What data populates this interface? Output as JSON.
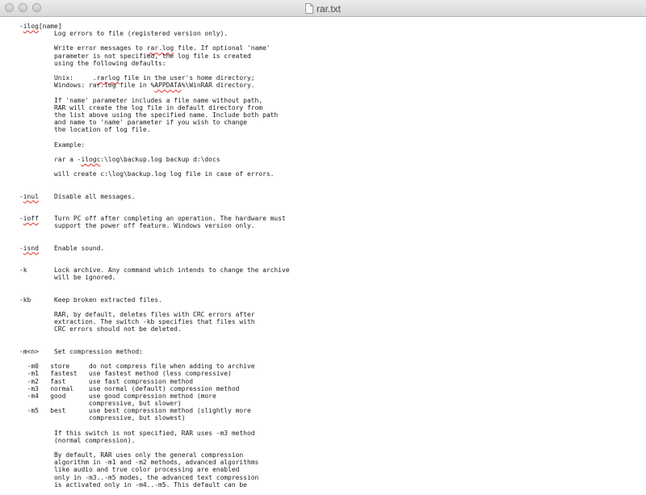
{
  "window": {
    "title": "rar.txt",
    "icon": "text-document-icon",
    "controls": [
      "close-button",
      "minimize-button",
      "zoom-button"
    ]
  },
  "text_lines": [
    "-ilog[name]",
    "         Log errors to file (registered version only).",
    "",
    "         Write error messages to rar.log file. If optional 'name'",
    "         parameter is not specified, the log file is created",
    "         using the following defaults:",
    "",
    "         Unix:     .rarlog file in the user's home directory;",
    "         Windows: rar.log file in %APPDATA%\\WinRAR directory.",
    "",
    "         If 'name' parameter includes a file name without path,",
    "         RAR will create the log file in default directory from",
    "         the list above using the specified name. Include both path",
    "         and name to 'name' parameter if you wish to change",
    "         the location of log file.",
    "",
    "         Example:",
    "",
    "         rar a -ilogc:\\log\\backup.log backup d:\\docs",
    "",
    "         will create c:\\log\\backup.log log file in case of errors.",
    "",
    "",
    "-inul    Disable all messages.",
    "",
    "",
    "-ioff    Turn PC off after completing an operation. The hardware must",
    "         support the power off feature. Windows version only.",
    "",
    "",
    "-isnd    Enable sound.",
    "",
    "",
    "-k       Lock archive. Any command which intends to change the archive",
    "         will be ignored.",
    "",
    "",
    "-kb      Keep broken extracted files.",
    "",
    "         RAR, by default, deletes files with CRC errors after",
    "         extraction. The switch -kb specifies that files with",
    "         CRC errors should not be deleted.",
    "",
    "",
    "-m<n>    Set compression method:",
    "",
    "  -m0   store     do not compress file when adding to archive",
    "  -m1   fastest   use fastest method (less compressive)",
    "  -m2   fast      use fast compression method",
    "  -m3   normal    use normal (default) compression method",
    "  -m4   good      use good compression method (more",
    "                  compressive, but slower)",
    "  -m5   best      use best compression method (slightly more",
    "                  compressive, but slowest)",
    "",
    "         If this switch is not specified, RAR uses -m3 method",
    "         (normal compression).",
    "",
    "         By default, RAR uses only the general compression",
    "         algorithm in -m1 and -m2 methods, advanced algorithms",
    "         like audio and true color processing are enabled",
    "         only in -m3..-m5 modes, the advanced text compression",
    "         is activated only in -m4..-m5. This default can be"
  ],
  "spell_marked": [
    {
      "line": 0,
      "word": "ilog"
    },
    {
      "line": 3,
      "word": "rar.log"
    },
    {
      "line": 7,
      "word": "rarlog"
    },
    {
      "line": 8,
      "word": "APPDATA"
    },
    {
      "line": 18,
      "word": "ilogc"
    },
    {
      "line": 23,
      "word": "inul"
    },
    {
      "line": 26,
      "word": "ioff"
    },
    {
      "line": 30,
      "word": "isnd"
    }
  ]
}
